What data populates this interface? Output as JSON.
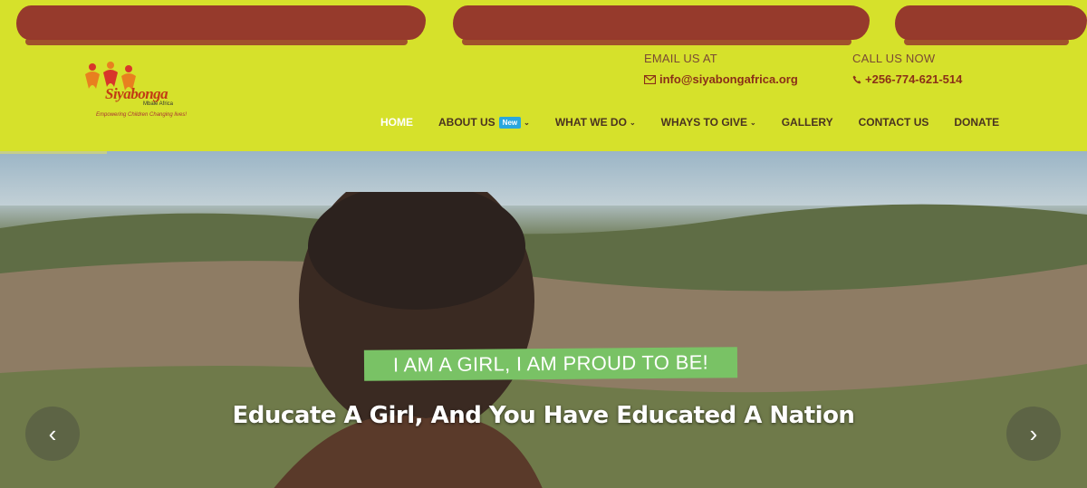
{
  "logo": {
    "name": "Siyabonga",
    "sub": "Mbale Africa",
    "tagline": "Empowering Children Changing lives!"
  },
  "contact": {
    "email_label": "EMAIL US AT",
    "email_value": "info@siyabongafrica.org",
    "phone_label": "CALL US NOW",
    "phone_value": "+256-774-621-514",
    "email_icon": "envelope-icon",
    "phone_icon": "phone-icon"
  },
  "nav": {
    "home": "HOME",
    "about": "ABOUT US",
    "about_badge": "New",
    "what_we_do": "WHAT WE DO",
    "ways_to_give": "WHAYS TO GIVE",
    "gallery": "GALLERY",
    "contact": "CONTACT US",
    "donate": "DONATE"
  },
  "hero": {
    "headline": "I AM A GIRL, I AM PROUD TO BE!",
    "subheadline": "Educate A Girl, And You Have Educated A Nation",
    "prev_icon": "chevron-left-icon",
    "next_icon": "chevron-right-icon"
  },
  "colors": {
    "header_bg": "#d6e12b",
    "brush": "#963a2c",
    "accent_green": "#79c265",
    "badge_blue": "#29a7de"
  }
}
